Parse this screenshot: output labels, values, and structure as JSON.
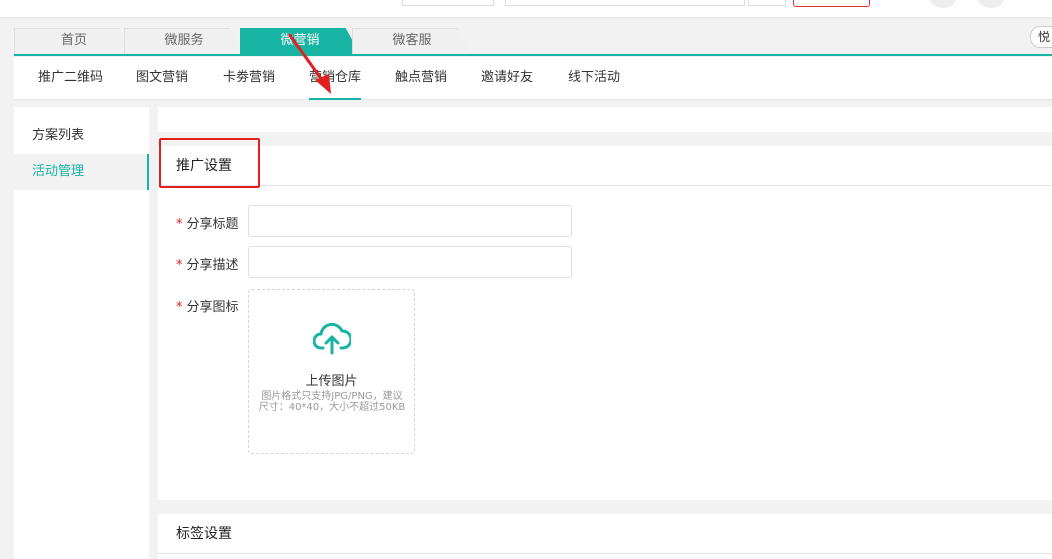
{
  "tabs": [
    {
      "label": "首页"
    },
    {
      "label": "微服务"
    },
    {
      "label": "微营销"
    },
    {
      "label": "微客服"
    }
  ],
  "user_chip": "悦",
  "subnav": [
    {
      "label": "推广二维码"
    },
    {
      "label": "图文营销"
    },
    {
      "label": "卡劵营销"
    },
    {
      "label": "营销仓库"
    },
    {
      "label": "触点营销"
    },
    {
      "label": "邀请好友"
    },
    {
      "label": "线下活动"
    }
  ],
  "sidebar": [
    {
      "label": "方案列表"
    },
    {
      "label": "活动管理"
    }
  ],
  "promo": {
    "title": "推广设置",
    "share_title_label": "分享标题",
    "share_desc_label": "分享描述",
    "share_icon_label": "分享图标",
    "upload_title": "上传图片",
    "upload_tip": "图片格式只支持JPG/PNG，建议尺寸：40*40，大小不超过50KB"
  },
  "tag_section": {
    "title": "标签设置"
  },
  "colors": {
    "accent": "#17b3a3",
    "highlight": "#e02020"
  }
}
